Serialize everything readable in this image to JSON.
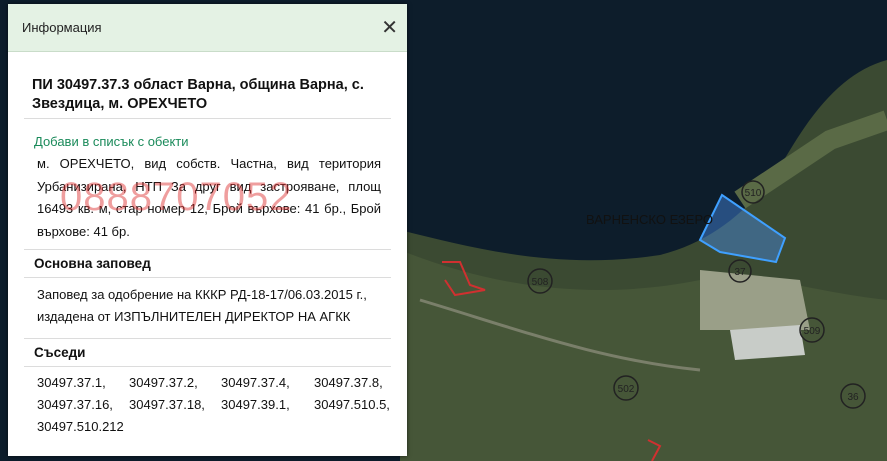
{
  "panel": {
    "title": "Информация",
    "close_label": "✕"
  },
  "parcel": {
    "title": "ПИ 30497.37.3 област Варна, община Варна, с. Звездица, м. ОРЕХЧЕТО",
    "add_link": "Добави в списък с обекти",
    "description": "м. ОРЕХЧЕТО, вид собств. Частна, вид територия Урбанизирана, НТП За друг вид застрояване, площ 16493 кв. м, стар номер 12, Брой върхове: 41 бр., Брой върхове: 41 бр.",
    "watermark": "0888707052"
  },
  "order": {
    "heading": "Основна заповед",
    "text": "Заповед за одобрение на КККР РД-18-17/06.03.2015 г., издадена от ИЗПЪЛНИТЕЛЕН ДИРЕКТОР НА АГКК"
  },
  "neighbors": {
    "heading": "Съседи",
    "items": [
      "30497.37.1,",
      "30497.37.2,",
      "30497.37.4,",
      "30497.37.8,",
      "30497.37.16,",
      "30497.37.18,",
      "30497.39.1,",
      "30497.510.5,",
      "30497.510.212"
    ]
  },
  "map": {
    "lake_label": "ВАРНЕНСКО ЕЗЕРО",
    "road_labels": [
      "510",
      "37",
      "508",
      "509",
      "502",
      "36"
    ]
  }
}
